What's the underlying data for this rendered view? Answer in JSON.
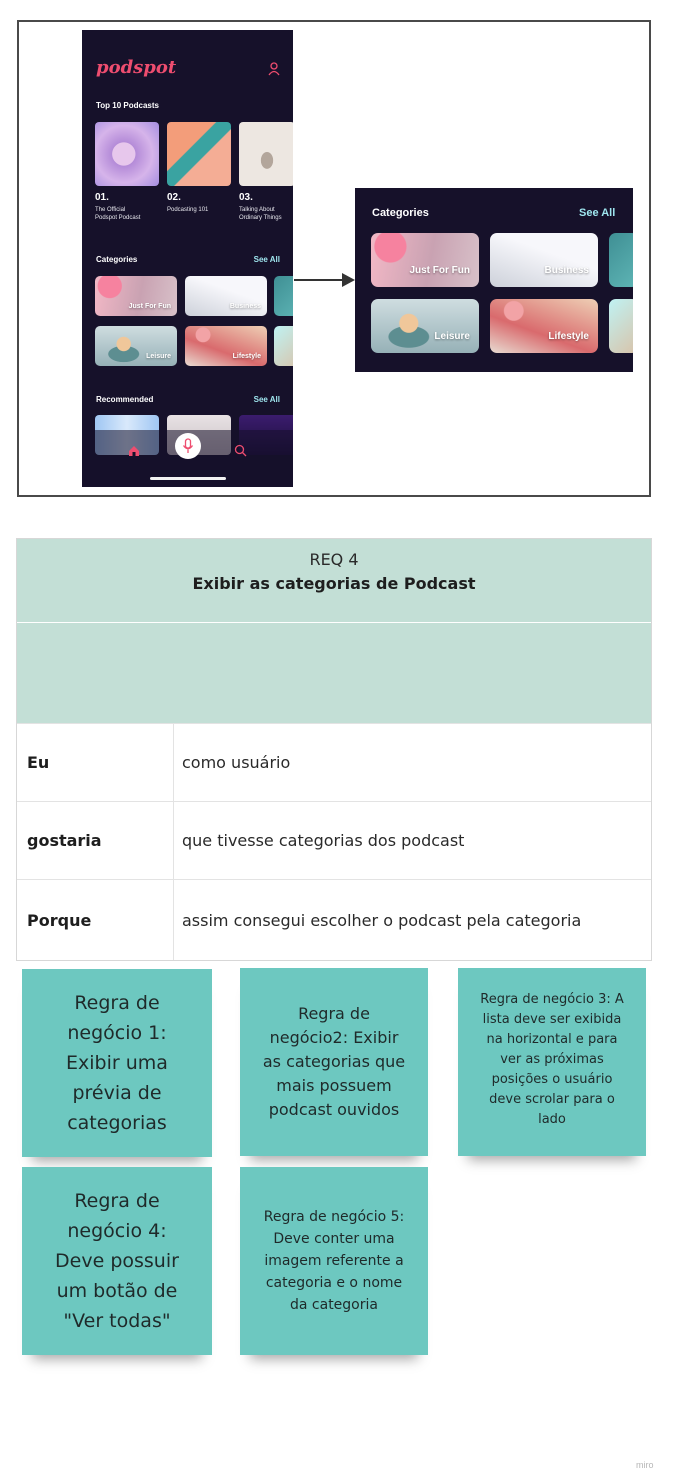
{
  "app": {
    "logo": "podspot",
    "top10_title": "Top 10 Podcasts",
    "top10": [
      {
        "num": "01.",
        "title": "The Official\nPodspot Podcast"
      },
      {
        "num": "02.",
        "title": "Podcasting 101"
      },
      {
        "num": "03.",
        "title": "Talking About\nOrdinary Things"
      }
    ],
    "categories_title": "Categories",
    "see_all": "See All",
    "categories": [
      "Just For Fun",
      "Business",
      "Leisure",
      "Lifestyle"
    ],
    "recommended_title": "Recommended",
    "colors": {
      "accent": "#ee4d6f",
      "background": "#16112a",
      "link": "#9fe6ef"
    }
  },
  "requirement": {
    "id": "REQ 4",
    "title": "Exibir as categorias de Podcast",
    "rows": [
      {
        "key": "Eu",
        "value": "como usuário"
      },
      {
        "key": "gostaria",
        "value": "que tivesse categorias dos podcast"
      },
      {
        "key": "Porque",
        "value": "assim consegui escolher o podcast pela categoria"
      }
    ]
  },
  "notes": [
    {
      "lines": [
        "Regra de",
        "negócio 1:",
        "Exibir uma",
        "prévia de",
        "categorias"
      ]
    },
    {
      "lines": [
        "Regra de",
        "negócio2: Exibir",
        "as categorias  que",
        "mais possuem",
        "podcast ouvidos"
      ]
    },
    {
      "lines": [
        "Regra de negócio 3: A",
        "lista deve ser exibida",
        "na horizontal e para",
        "ver as próximas",
        "posições o usuário",
        "deve scrolar para o",
        "lado"
      ]
    },
    {
      "lines": [
        "Regra de",
        "negócio 4:",
        "Deve possuir",
        "um botão de",
        "\"Ver todas\""
      ]
    },
    {
      "lines": [
        "Regra de negócio 5:",
        "Deve conter uma",
        "imagem referente a",
        "categoria e o nome",
        "da categoria"
      ]
    }
  ],
  "watermark": "miro"
}
